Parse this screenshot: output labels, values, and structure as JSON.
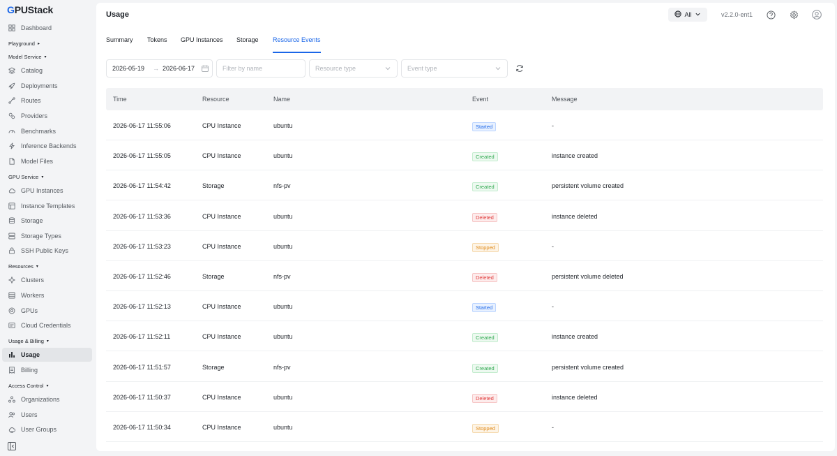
{
  "app": {
    "logo_text": "GPUStack"
  },
  "sidebar": {
    "items": [
      {
        "key": "dashboard",
        "label": "Dashboard",
        "icon": "grid-icon"
      },
      {
        "group": true,
        "label": "Playground",
        "caret": "▸"
      },
      {
        "group": true,
        "label": "Model Service",
        "caret": "▾"
      },
      {
        "key": "catalog",
        "label": "Catalog",
        "icon": "layers-icon"
      },
      {
        "key": "deployments",
        "label": "Deployments",
        "icon": "rocket-icon"
      },
      {
        "key": "routes",
        "label": "Routes",
        "icon": "route-icon"
      },
      {
        "key": "providers",
        "label": "Providers",
        "icon": "providers-icon"
      },
      {
        "key": "benchmarks",
        "label": "Benchmarks",
        "icon": "gauge-icon"
      },
      {
        "key": "inference-backends",
        "label": "Inference Backends",
        "icon": "bolt-icon"
      },
      {
        "key": "model-files",
        "label": "Model Files",
        "icon": "file-icon"
      },
      {
        "group": true,
        "label": "GPU Service",
        "caret": "▾"
      },
      {
        "key": "gpu-instances",
        "label": "GPU Instances",
        "icon": "cloud-icon"
      },
      {
        "key": "instance-templates",
        "label": "Instance Templates",
        "icon": "template-icon"
      },
      {
        "key": "storage",
        "label": "Storage",
        "icon": "database-icon"
      },
      {
        "key": "storage-types",
        "label": "Storage Types",
        "icon": "storage-types-icon"
      },
      {
        "key": "ssh-public-keys",
        "label": "SSH Public Keys",
        "icon": "lock-icon"
      },
      {
        "group": true,
        "label": "Resources",
        "caret": "▾"
      },
      {
        "key": "clusters",
        "label": "Clusters",
        "icon": "cluster-icon"
      },
      {
        "key": "workers",
        "label": "Workers",
        "icon": "server-icon"
      },
      {
        "key": "gpus",
        "label": "GPUs",
        "icon": "chip-icon"
      },
      {
        "key": "cloud-credentials",
        "label": "Cloud Credentials",
        "icon": "credentials-icon"
      },
      {
        "group": true,
        "label": "Usage & Billing",
        "caret": "▾"
      },
      {
        "key": "usage",
        "label": "Usage",
        "icon": "bar-chart-icon",
        "active": true
      },
      {
        "key": "billing",
        "label": "Billing",
        "icon": "billing-icon"
      },
      {
        "group": true,
        "label": "Access Control",
        "caret": "▾"
      },
      {
        "key": "organizations",
        "label": "Organizations",
        "icon": "org-icon"
      },
      {
        "key": "users",
        "label": "Users",
        "icon": "users-icon"
      },
      {
        "key": "user-groups",
        "label": "User Groups",
        "icon": "user-groups-icon"
      }
    ]
  },
  "header": {
    "title": "Usage",
    "scope": "All",
    "version": "v2.2.0-ent1"
  },
  "tabs": [
    {
      "label": "Summary"
    },
    {
      "label": "Tokens"
    },
    {
      "label": "GPU Instances"
    },
    {
      "label": "Storage"
    },
    {
      "label": "Resource Events",
      "active": true
    }
  ],
  "filters": {
    "date_start": "2026-05-19",
    "date_sep": "→",
    "date_end": "2026-06-17",
    "name_placeholder": "Filter by name",
    "resource_type_placeholder": "Resource type",
    "event_type_placeholder": "Event type"
  },
  "table": {
    "columns": [
      "Time",
      "Resource",
      "Name",
      "Event",
      "Message"
    ],
    "rows": [
      {
        "time": "2026-06-17 11:55:06",
        "resource": "CPU Instance",
        "name": "ubuntu",
        "event": "Started",
        "status": "started",
        "message": "-"
      },
      {
        "time": "2026-06-17 11:55:05",
        "resource": "CPU Instance",
        "name": "ubuntu",
        "event": "Created",
        "status": "created",
        "message": "instance created"
      },
      {
        "time": "2026-06-17 11:54:42",
        "resource": "Storage",
        "name": "nfs-pv",
        "event": "Created",
        "status": "created",
        "message": "persistent volume created"
      },
      {
        "time": "2026-06-17 11:53:36",
        "resource": "CPU Instance",
        "name": "ubuntu",
        "event": "Deleted",
        "status": "deleted",
        "message": "instance deleted"
      },
      {
        "time": "2026-06-17 11:53:23",
        "resource": "CPU Instance",
        "name": "ubuntu",
        "event": "Stopped",
        "status": "stopped",
        "message": "-"
      },
      {
        "time": "2026-06-17 11:52:46",
        "resource": "Storage",
        "name": "nfs-pv",
        "event": "Deleted",
        "status": "deleted",
        "message": "persistent volume deleted"
      },
      {
        "time": "2026-06-17 11:52:13",
        "resource": "CPU Instance",
        "name": "ubuntu",
        "event": "Started",
        "status": "started",
        "message": "-"
      },
      {
        "time": "2026-06-17 11:52:11",
        "resource": "CPU Instance",
        "name": "ubuntu",
        "event": "Created",
        "status": "created",
        "message": "instance created"
      },
      {
        "time": "2026-06-17 11:51:57",
        "resource": "Storage",
        "name": "nfs-pv",
        "event": "Created",
        "status": "created",
        "message": "persistent volume created"
      },
      {
        "time": "2026-06-17 11:50:37",
        "resource": "CPU Instance",
        "name": "ubuntu",
        "event": "Deleted",
        "status": "deleted",
        "message": "instance deleted"
      },
      {
        "time": "2026-06-17 11:50:34",
        "resource": "CPU Instance",
        "name": "ubuntu",
        "event": "Stopped",
        "status": "stopped",
        "message": "-"
      }
    ]
  },
  "colors": {
    "accent": "#1a66e8",
    "started": "#1a66e8",
    "created": "#2fa84f",
    "deleted": "#e03a3a",
    "stopped": "#e08a1a"
  }
}
